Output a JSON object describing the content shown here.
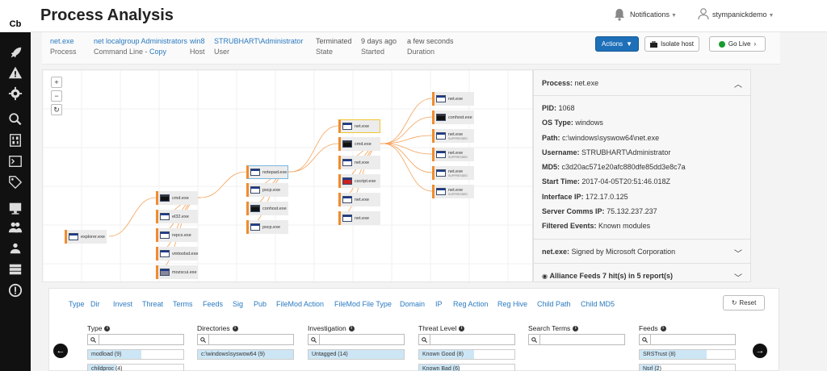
{
  "logo": "Cb",
  "header": {
    "title": "Process Analysis",
    "notifications": "Notifications",
    "user": "stympanickdemo"
  },
  "info": {
    "process": {
      "value": "net.exe",
      "label": "Process"
    },
    "cmdline": {
      "value": "net localgroup Administrators",
      "label": "Command Line - ",
      "copy": "Copy"
    },
    "host": {
      "value": "win8",
      "label": "Host"
    },
    "user": {
      "value": "STRUBHART\\Administrator",
      "label": "User"
    },
    "state": {
      "value": "Terminated",
      "label": "State"
    },
    "started": {
      "value": "9 days ago",
      "label": "Started"
    },
    "duration": {
      "value": "a few seconds",
      "label": "Duration"
    }
  },
  "actions": {
    "actions": "Actions",
    "isolate": "Isolate host",
    "golive": "Go Live"
  },
  "graph": {
    "zoom_in": "+",
    "zoom_out": "−",
    "refresh": "↻",
    "nodes": [
      {
        "id": "explorer",
        "label": "explorer.exe"
      },
      {
        "id": "cmd1",
        "label": "cmd.exe"
      },
      {
        "id": "el32",
        "label": "el32.exe"
      },
      {
        "id": "repcx",
        "label": "repcx.exe"
      },
      {
        "id": "vmtoolsd",
        "label": "vmtoolsd.exe"
      },
      {
        "id": "mozsc",
        "label": "mozscui.exe"
      },
      {
        "id": "notepad",
        "label": "notepad.exe"
      },
      {
        "id": "pscp1",
        "label": "pscp.exe"
      },
      {
        "id": "conhost1",
        "label": "conhost.exe"
      },
      {
        "id": "pscp2",
        "label": "pscp.exe"
      },
      {
        "id": "net1",
        "label": "net.exe"
      },
      {
        "id": "cmd2",
        "label": "cmd.exe"
      },
      {
        "id": "net2",
        "label": "net.exe"
      },
      {
        "id": "cscript",
        "label": "cscript.exe"
      },
      {
        "id": "net3",
        "label": "net.exe"
      },
      {
        "id": "net4",
        "label": "net.exe"
      },
      {
        "id": "r1",
        "label": "net.exe"
      },
      {
        "id": "r2",
        "label": "conhost.exe"
      },
      {
        "id": "r3",
        "label": "net.exe",
        "sub": "SUPPRESSED"
      },
      {
        "id": "r4",
        "label": "net.exe",
        "sub": "SUPPRESSED"
      },
      {
        "id": "r5",
        "label": "net.exe",
        "sub": "SUPPRESSED"
      },
      {
        "id": "r6",
        "label": "net.exe",
        "sub": "SUPPRESSED"
      }
    ]
  },
  "panel": {
    "head_label": "Process:",
    "head_value": "net.exe",
    "details": [
      {
        "k": "PID:",
        "v": "1068"
      },
      {
        "k": "OS Type:",
        "v": "windows"
      },
      {
        "k": "Path:",
        "v": "c:\\windows\\syswow64\\net.exe"
      },
      {
        "k": "Username:",
        "v": "STRUBHART\\Administrator"
      },
      {
        "k": "MD5:",
        "v": "c3d20ac571e20afc880dfe85dd3e8c7a"
      },
      {
        "k": "Start Time:",
        "v": "2017-04-05T20:51:46.018Z"
      },
      {
        "k": "Interface IP:",
        "v": "172.17.0.125"
      },
      {
        "k": "Server Comms IP:",
        "v": "75.132.237.237"
      },
      {
        "k": "Filtered Events:",
        "v": "Known modules"
      }
    ],
    "signed_label": "net.exe:",
    "signed_value": "Signed by Microsoft Corporation",
    "alliance": "Alliance Feeds 7 hit(s) in 5 report(s)"
  },
  "facets": {
    "tabs": [
      "Type",
      "Dir",
      "Invest",
      "Threat",
      "Terms",
      "Feeds",
      "Sig",
      "Pub",
      "FileMod Action",
      "FileMod File Type",
      "Domain",
      "IP",
      "Reg Action",
      "Reg Hive",
      "Child Path",
      "Child MD5"
    ],
    "reset": "Reset",
    "columns": [
      {
        "title": "Type",
        "bars": [
          {
            "label": "modload (9)",
            "fill": 0.56
          },
          {
            "label": "childproc (4)",
            "fill": 0.3
          }
        ]
      },
      {
        "title": "Directories",
        "bars": [
          {
            "label": "c:\\windows\\syswow64 (9)",
            "fill": 1.0
          }
        ]
      },
      {
        "title": "Investigation",
        "bars": [
          {
            "label": "Untagged (14)",
            "fill": 1.0
          }
        ]
      },
      {
        "title": "Threat Level",
        "bars": [
          {
            "label": "Known Good (8)",
            "fill": 0.58
          },
          {
            "label": "Known Bad (6)",
            "fill": 0.42
          }
        ]
      },
      {
        "title": "Search Terms",
        "bars": []
      },
      {
        "title": "Feeds",
        "bars": [
          {
            "label": "SRSTrust (8)",
            "fill": 0.7
          },
          {
            "label": "Nsrl (2)",
            "fill": 0.2
          }
        ]
      }
    ]
  }
}
